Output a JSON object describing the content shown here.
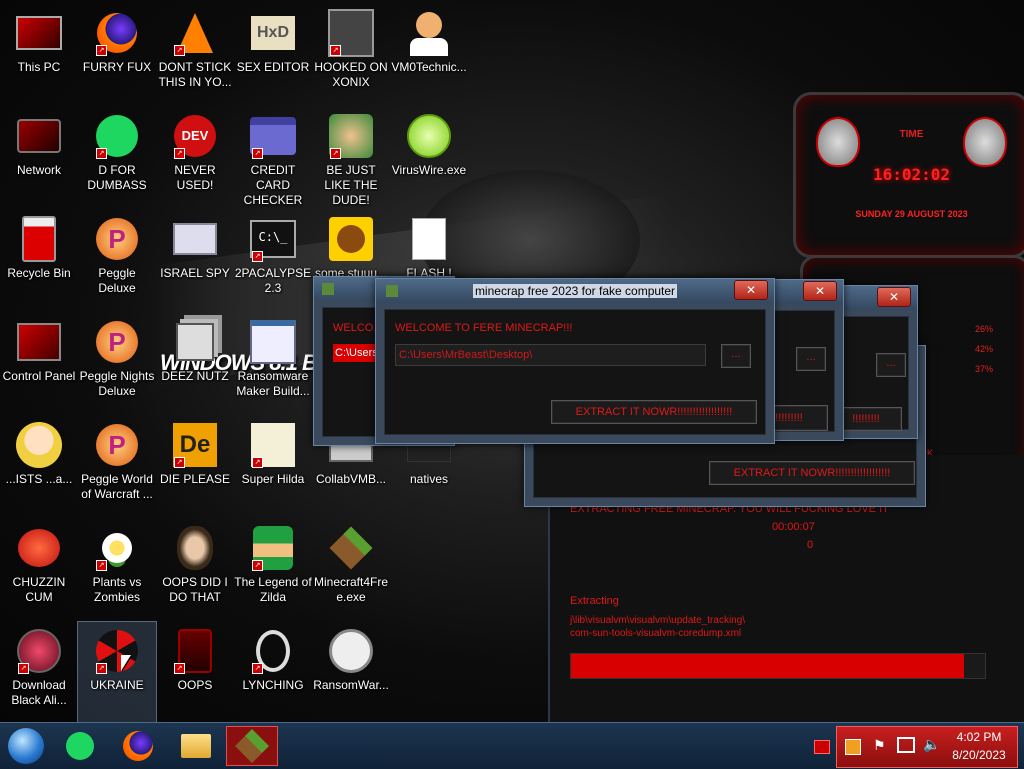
{
  "desktop_icons": [
    {
      "label": "This PC",
      "icon": "monitor-icon"
    },
    {
      "label": "FURRY FUX",
      "icon": "firefox-icon"
    },
    {
      "label": "DONT STICK THIS IN YO...",
      "icon": "vlc-cone-icon"
    },
    {
      "label": "SEX EDITOR",
      "icon": "hxd-editor-icon"
    },
    {
      "label": "HOOKED ON XONIX",
      "icon": "xonix-game-icon"
    },
    {
      "label": "VM0Technic...",
      "icon": "doctor-icon"
    },
    {
      "label": "Network",
      "icon": "network-icon"
    },
    {
      "label": "D FOR DUMBASS",
      "icon": "spotify-icon"
    },
    {
      "label": "NEVER USED!",
      "icon": "dev-cpp-icon"
    },
    {
      "label": "CREDIT CARD CHECKER",
      "icon": "credit-card-icon"
    },
    {
      "label": "BE JUST LIKE THE DUDE!",
      "icon": "santa-elf-icon"
    },
    {
      "label": "VirusWire.exe",
      "icon": "lime-icon"
    },
    {
      "label": "Recycle Bin",
      "icon": "recycle-bin-icon"
    },
    {
      "label": "Peggle Deluxe",
      "icon": "peggle-icon"
    },
    {
      "label": "ISRAEL SPY",
      "icon": "remote-desktop-icon"
    },
    {
      "label": "2PACALYPSE 2.3",
      "icon": "terminal-icon"
    },
    {
      "label": "some stuuu...",
      "icon": "beaver-icon"
    },
    {
      "label": "FLASH !",
      "icon": "flash-doc-icon"
    },
    {
      "label": "Control Panel",
      "icon": "control-panel-icon"
    },
    {
      "label": "Peggle Nights Deluxe",
      "icon": "peggle-icon"
    },
    {
      "label": "DEEZ NUTZ",
      "icon": "windows-stack-icon"
    },
    {
      "label": "Ransomware Maker Build...",
      "icon": "app-window-icon"
    },
    {
      "label": "...ISTS ...a...",
      "icon": "star-girl-icon"
    },
    {
      "label": "Peggle World of Warcraft ...",
      "icon": "peggle-icon"
    },
    {
      "label": "DIE PLEASE",
      "icon": "director-icon"
    },
    {
      "label": "Super Hilda",
      "icon": "pixel-dog-icon"
    },
    {
      "label": "CollabVMB...",
      "icon": "collabvm-icon"
    },
    {
      "label": "natives",
      "icon": "folder-icon"
    },
    {
      "label": "CHUZZIN CUM",
      "icon": "chuzzle-icon"
    },
    {
      "label": "Plants vs Zombies",
      "icon": "flower-icon"
    },
    {
      "label": "OOPS DID I DO THAT",
      "icon": "portrait-icon"
    },
    {
      "label": "The Legend of Zilda",
      "icon": "zelda-icon"
    },
    {
      "label": "Minecraft4Free.exe",
      "icon": "grass-block-icon"
    },
    {
      "label": "Download Black Ali...",
      "icon": "alien-orb-icon"
    },
    {
      "label": "UKRAINE",
      "icon": "radiation-icon"
    },
    {
      "label": "OOPS",
      "icon": "alienware-icon"
    },
    {
      "label": "LYNCHING",
      "icon": "noose-icon"
    },
    {
      "label": "RansomWar...",
      "icon": "skull-icon"
    }
  ],
  "watermark": "WINDOWS 8.1 BL",
  "widget": {
    "time_label": "TIME",
    "time": "16:02:02",
    "date": "SUNDAY 29 AUGUST 2023",
    "cpu_values": [
      "26%",
      "42%",
      "37%"
    ],
    "footer": "...RK"
  },
  "windows": {
    "front": {
      "title": "minecrap free 2023 for fake computer",
      "welcome": "WELCOME TO FERE MINECRAP!!!",
      "path": "C:\\Users\\MrBeast\\Desktop\\",
      "browse": "...",
      "extract": "EXTRACT IT NOWR!!!!!!!!!!!!!!!!!!"
    },
    "left": {
      "welcome": "WELCO...",
      "path": "C:\\Users..."
    },
    "mid": {
      "extract_tail": "!!!!!!!!!",
      "browse": "..."
    },
    "right": {
      "extract_tail": "!!!!!!!!!",
      "browse": "..."
    },
    "lower": {
      "extract": "EXTRACT IT NOWR!!!!!!!!!!!!!!!!!!"
    },
    "console": {
      "header": "EXTRACTING FREE MINECRAP. YOU WILL FUCKING LOVE IT",
      "timer": "00:00:07",
      "count": "0",
      "status": "Extracting",
      "file_line1": "j\\lib\\visualvm\\visualvm\\update_tracking\\",
      "file_line2": "com-sun-tools-visualvm-coredump.xml",
      "progress": 0.95
    }
  },
  "taskbar": {
    "items": [
      "start-orb-icon",
      "spotify-icon",
      "firefox-icon",
      "file-explorer-icon",
      "minecraft-running-icon"
    ]
  },
  "tray": {
    "time": "4:02 PM",
    "date": "8/20/2023",
    "icons": [
      "show-hidden-icon",
      "java-update-icon",
      "flag-icon",
      "network-tray-icon",
      "volume-icon"
    ]
  },
  "colors": {
    "accent": "#e01818",
    "taskbar": "#14304c",
    "window_frame": "#3a4a5c"
  }
}
